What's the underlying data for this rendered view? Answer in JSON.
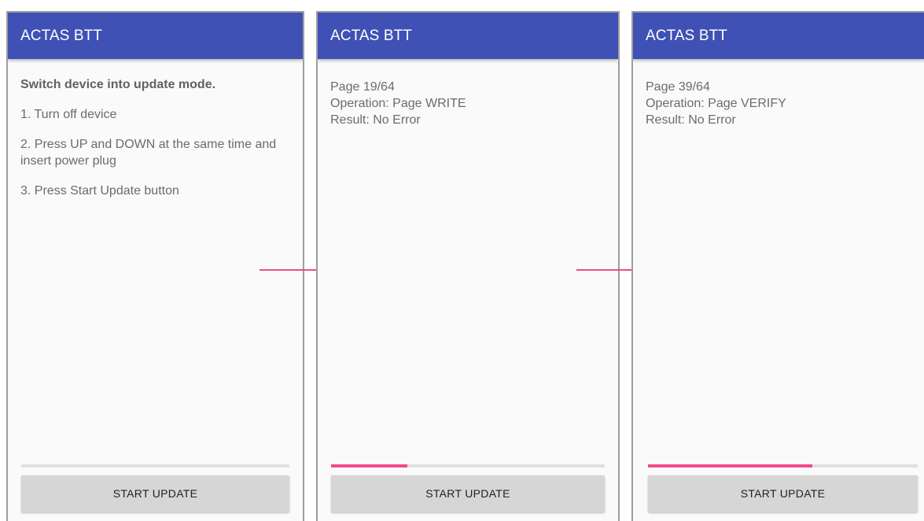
{
  "accent_colors": {
    "appbar": "#3f51b5",
    "progress": "#f04a8c",
    "arrow": "#f04a8c"
  },
  "screens": [
    {
      "app_title": "ACTAS BTT",
      "instructions": {
        "heading": "Switch device into update mode.",
        "steps": [
          "1. Turn off device",
          "2. Press UP and DOWN at the same time and insert power plug",
          "3. Press Start Update button"
        ]
      },
      "progress": 0,
      "button_label": "START UPDATE"
    },
    {
      "app_title": "ACTAS BTT",
      "status": {
        "page": "Page 19/64",
        "operation": "Operation: Page WRITE",
        "result": "Result: No Error"
      },
      "progress": 0.28,
      "button_label": "START UPDATE"
    },
    {
      "app_title": "ACTAS BTT",
      "status": {
        "page": "Page 39/64",
        "operation": "Operation: Page VERIFY",
        "result": "Result: No Error"
      },
      "progress": 0.61,
      "button_label": "START UPDATE"
    }
  ],
  "transition_arrows": [
    "arrow-right-icon",
    "arrow-right-icon"
  ]
}
